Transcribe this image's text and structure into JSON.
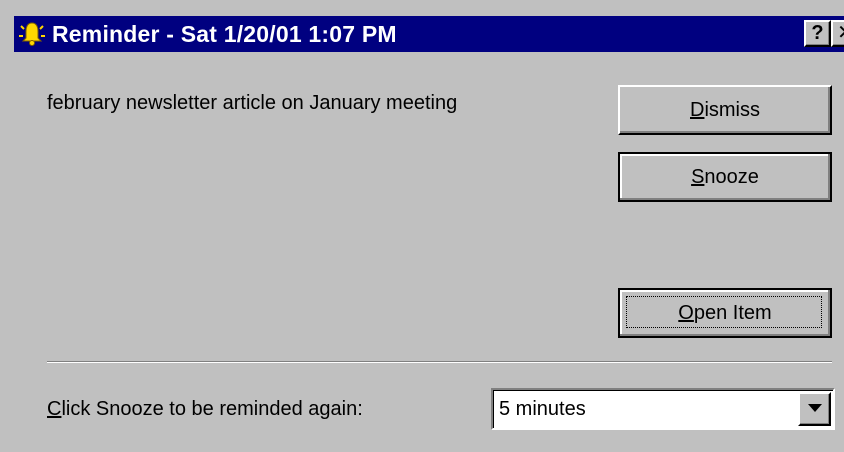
{
  "window": {
    "title": "Reminder - Sat 1/20/01 1:07 PM",
    "icon": "bell-icon",
    "help_label": "?",
    "close_label": "✕"
  },
  "reminder": {
    "message": "february newsletter article on January meeting"
  },
  "buttons": {
    "dismiss": {
      "prefix": "",
      "mnemonic": "D",
      "rest": "ismiss"
    },
    "snooze": {
      "prefix": "",
      "mnemonic": "S",
      "rest": "nooze"
    },
    "open_item": {
      "prefix": "",
      "mnemonic": "O",
      "rest": "pen Item"
    }
  },
  "snooze": {
    "label_mnemonic": "C",
    "label_rest": "lick Snooze to be reminded again:",
    "selected": "5 minutes"
  },
  "colors": {
    "titlebar": "#000080",
    "face": "#c0c0c0",
    "bell": "#ffd700"
  }
}
